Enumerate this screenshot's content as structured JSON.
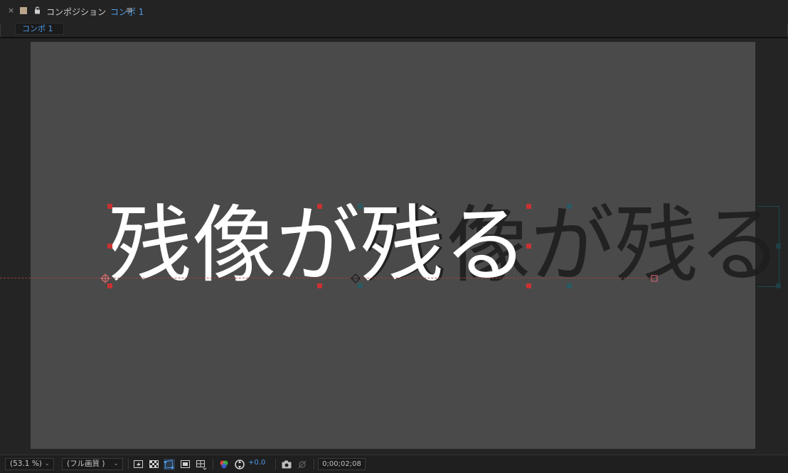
{
  "header": {
    "close_glyph": "×",
    "panel_label": "コンポジション",
    "comp_name": "コンポ 1",
    "menu_glyph": "≡"
  },
  "tab": {
    "label": "コンポ 1"
  },
  "viewer": {
    "main_text": "残像が残る",
    "shadow_text": "残像が残る"
  },
  "toolbar": {
    "zoom_value": "(53.1 %)",
    "resolution_value": "(フル画質 )",
    "exposure_value": "+0.0",
    "timecode": "0;00;02;08"
  },
  "colors": {
    "accent": "#4d9ae8",
    "canvas_bg": "#4a4a4a",
    "panel_bg": "#232323",
    "handle_red": "#c83232",
    "handle_teal": "#2a5a62"
  }
}
